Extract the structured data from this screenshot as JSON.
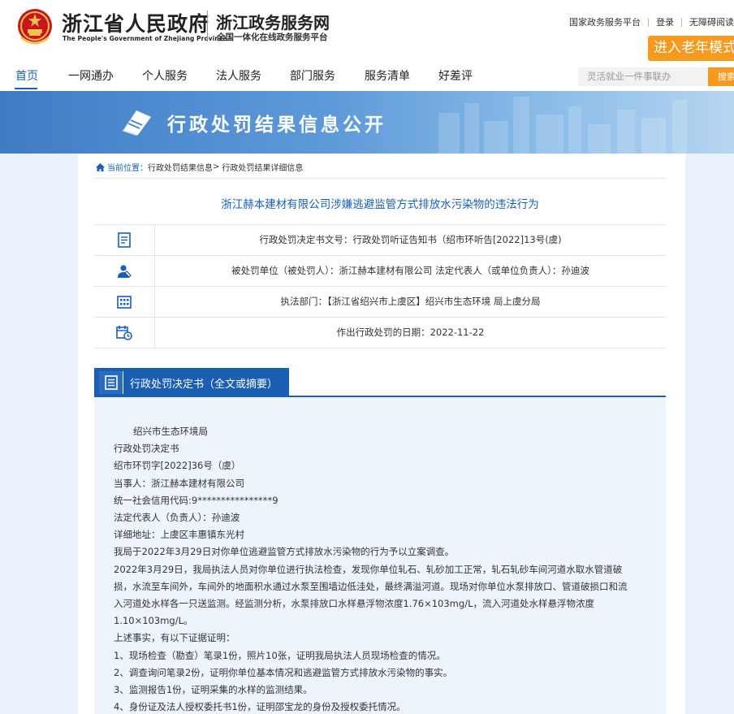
{
  "header": {
    "gov_title": "浙江省人民政府",
    "gov_subtitle_en": "The People's Government of Zhejiang Province",
    "service_title": "浙江政务服务网",
    "service_subtitle": "全国一体化在线政务服务平台",
    "top_links": [
      "国家政务服务平台",
      "登录",
      "无障碍阅读"
    ],
    "elder_mode_label": "进入老年模式"
  },
  "nav": {
    "items": [
      "首页",
      "一网通办",
      "个人服务",
      "法人服务",
      "部门服务",
      "服务清单",
      "好差评"
    ],
    "active_index": 0,
    "search_placeholder": "灵活就业一件事联办",
    "search_button": "搜索"
  },
  "banner": {
    "title": "行政处罚结果信息公开"
  },
  "breadcrumb": {
    "prefix": "当前位置：",
    "items": [
      "行政处罚结果信息",
      "行政处罚结果详细信息"
    ],
    "separator": ">"
  },
  "document": {
    "title": "浙江赫本建材有限公司涉嫌逃避监管方式排放水污染物的违法行为",
    "info_rows": [
      {
        "icon": "document-icon",
        "text": "行政处罚决定书文号：行政处罚听证告知书（绍市环听告[2022]13号(虞)"
      },
      {
        "icon": "person-icon",
        "text": "被处罚单位（被处罚人）：浙江赫本建材有限公司     法定代表人（或单位负责人）：孙迪波"
      },
      {
        "icon": "building-icon",
        "text": "执法部门：【浙江省绍兴市上虞区】绍兴市生态环境 局上虞分局"
      },
      {
        "icon": "calendar-icon",
        "text": "作出行政处罚的日期：2022-11-22"
      }
    ],
    "section_label": "行政处罚决定书（全文或摘要）",
    "full_text": [
      {
        "text": "绍兴市生态环境局",
        "indent": true
      },
      {
        "text": "行政处罚决定书",
        "indent": false
      },
      {
        "text": "绍市环罚字[2022]36号（虞）",
        "indent": false
      },
      {
        "text": "当事人：浙江赫本建材有限公司",
        "indent": false
      },
      {
        "text": "统一社会信用代码:9****************9",
        "indent": false
      },
      {
        "text": "法定代表人（负责人）：孙迪波",
        "indent": false
      },
      {
        "text": "详细地址：上虞区丰惠镇东光村",
        "indent": false
      },
      {
        "text": "我局于2022年3月29日对你单位逃避监管方式排放水污染物的行为予以立案调查。",
        "indent": false
      },
      {
        "text": "2022年3月29日，我局执法人员对你单位进行执法检查，发现你单位轧石、轧砂加工正常，轧石轧砂车间河道水取水管道破",
        "indent": false
      },
      {
        "text": "损，水流至车间外，车间外的地面积水通过水泵至围墙边低洼处，最终满溢河道。现场对你单位水泵排放口、管道破损口和流",
        "indent": false
      },
      {
        "text": "入河道处水样各一只送监测。经监测分析，水泵排放口水样悬浮物浓度1.76×103mg/L，流入河道处水样悬浮物浓度",
        "indent": false
      },
      {
        "text": "1.10×103mg/L。",
        "indent": false
      },
      {
        "text": "上述事实，有以下证据证明：",
        "indent": false
      },
      {
        "text": "1、现场检查（勘查）笔录1份，照片10张，证明我局执法人员现场检查的情况。",
        "indent": false
      },
      {
        "text": "2、调查询问笔录2份，证明你单位基本情况和逃避监管方式排放水污染物的事实。",
        "indent": false
      },
      {
        "text": "3、监测报告1份，证明采集的水样的监测结果。",
        "indent": false
      },
      {
        "text": "4、身份证及法人授权委托书1份，证明邵宝龙的身份及授权委托情况。",
        "indent": false
      }
    ]
  },
  "colors": {
    "primary_blue": "#1a5fb4",
    "accent_orange": "#f59a1e",
    "panel_bg": "#eef4fb"
  }
}
